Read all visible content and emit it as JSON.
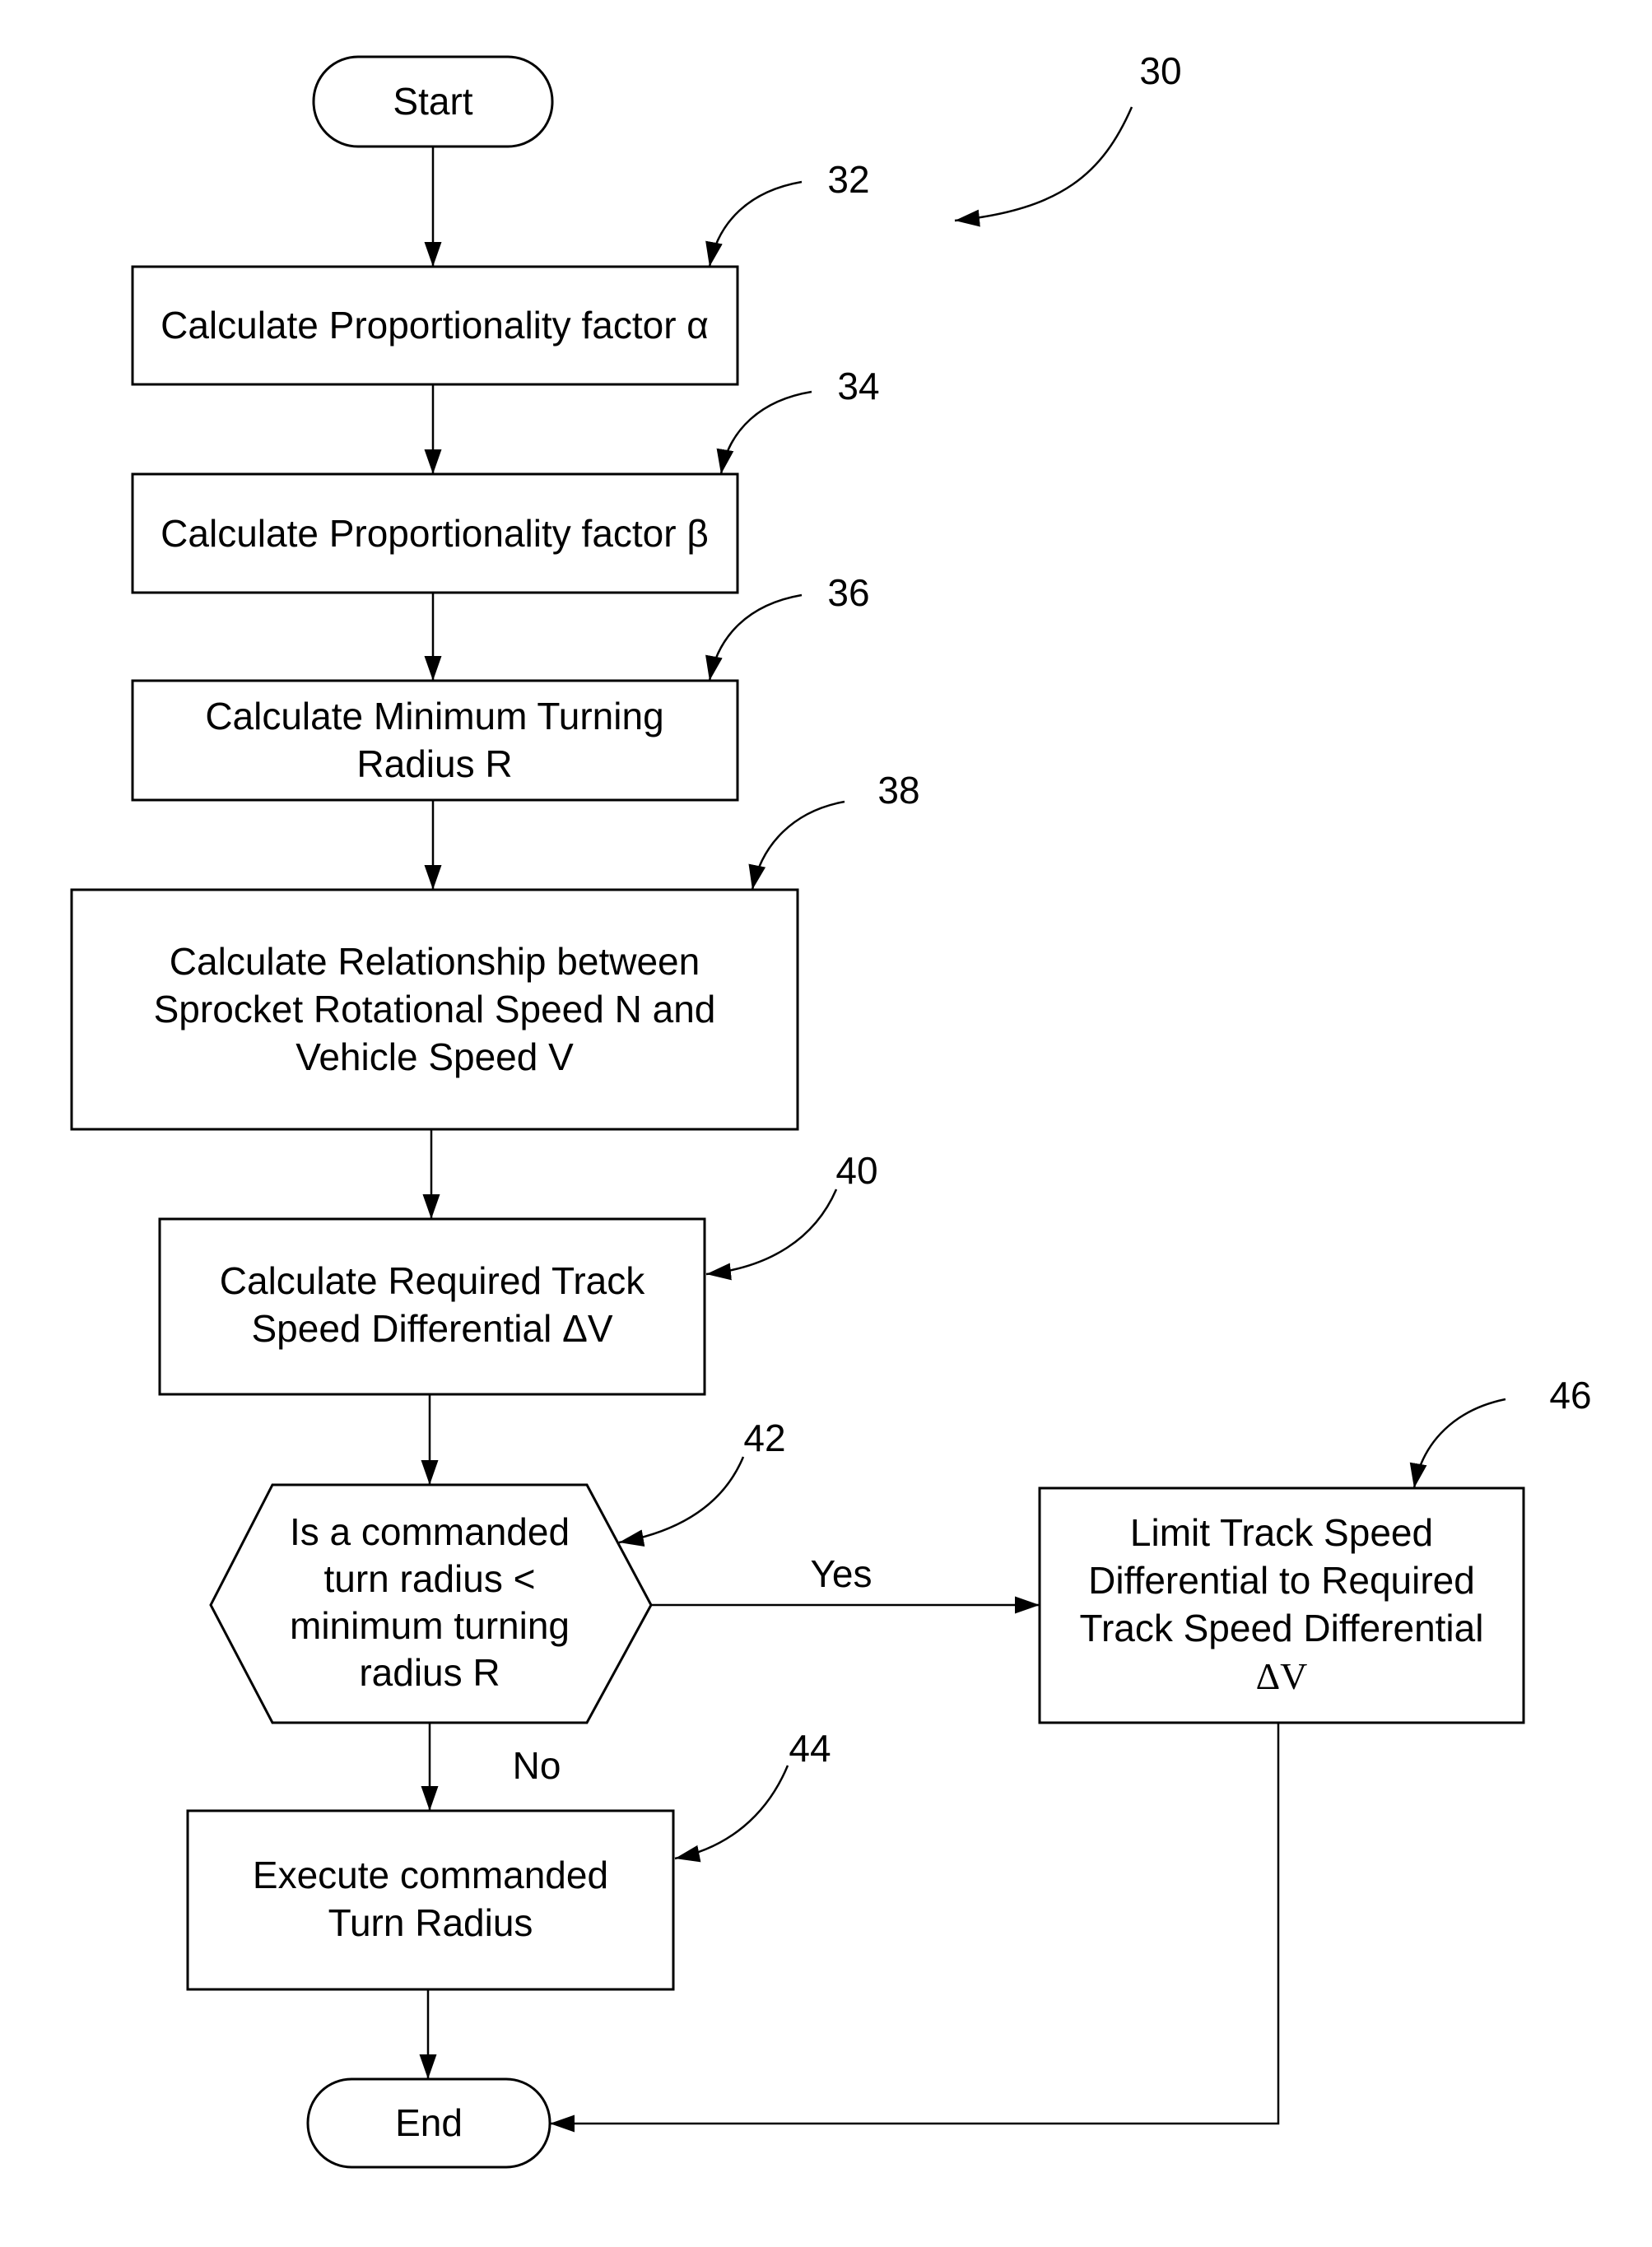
{
  "figure": {
    "reference": "30"
  },
  "nodes": {
    "start": {
      "label": "Start"
    },
    "step32": {
      "ref": "32",
      "lines": [
        "Calculate Proportionality factor α"
      ]
    },
    "step34": {
      "ref": "34",
      "lines": [
        "Calculate Proportionality factor β"
      ]
    },
    "step36": {
      "ref": "36",
      "lines": [
        "Calculate Minimum Turning",
        "Radius R"
      ]
    },
    "step38": {
      "ref": "38",
      "lines": [
        "Calculate Relationship between",
        "Sprocket Rotational Speed N and",
        "Vehicle Speed V"
      ]
    },
    "step40": {
      "ref": "40",
      "lines": [
        "Calculate Required Track",
        "Speed Differential ΔV"
      ]
    },
    "decision42": {
      "ref": "42",
      "lines": [
        "Is a commanded",
        "turn radius <",
        "minimum turning",
        "radius R"
      ]
    },
    "step44": {
      "ref": "44",
      "lines": [
        "Execute commanded",
        "Turn Radius"
      ]
    },
    "step46": {
      "ref": "46",
      "lines": [
        "Limit Track Speed",
        "Differential to Required",
        "Track Speed Differential",
        "ΔV"
      ]
    },
    "end": {
      "label": "End"
    }
  },
  "edges": {
    "yes_label": "Yes",
    "no_label": "No"
  }
}
